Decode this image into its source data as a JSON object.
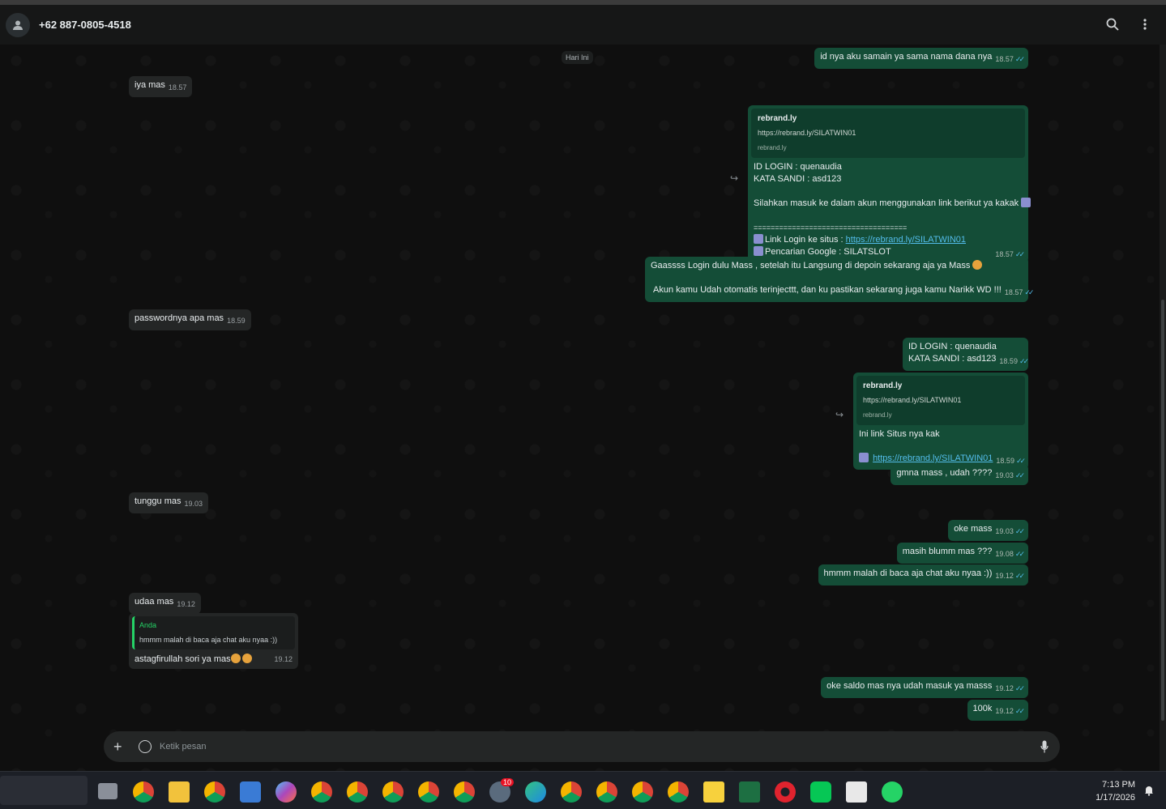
{
  "header": {
    "contact": "+62 887-0805-4518",
    "icons": [
      "person-icon",
      "search-icon",
      "more-vert-icon"
    ]
  },
  "chat": {
    "day_label": "Hari Ini",
    "messages": {
      "m1": {
        "text": "id nya aku samain ya sama nama dana nya",
        "time": "18.57"
      },
      "m2": {
        "text": "iya mas",
        "time": "18.57"
      },
      "m3": {
        "preview_title": "rebrand.ly",
        "preview_url": "https://rebrand.ly/SILATWIN01",
        "preview_domain": "rebrand.ly",
        "line1": "ID LOGIN : quenaudia",
        "line2": "KATA SANDI : asd123",
        "line3": "Silahkan masuk ke dalam akun menggunakan link berikut ya kakak",
        "line4": "====================================",
        "line5_prefix": "Link Login ke situs  : ",
        "line5_link": "https://rebrand.ly/SILATWIN01",
        "line6": "Pencarian Google : SILATSLOT",
        "time": "18.57"
      },
      "m4": {
        "line1": "Gaassss Login dulu Mass  , setelah itu Langsung di depoin sekarang aja ya Mass",
        "line2": "Akun kamu Udah otomatis terinjecttt, dan ku pastikan sekarang juga kamu Narikk WD !!!",
        "time": "18.57"
      },
      "m5": {
        "text": "passwordnya apa mas",
        "time": "18.59"
      },
      "m6": {
        "line1": "ID LOGIN : quenaudia",
        "line2": "KATA SANDI : asd123",
        "time": "18.59"
      },
      "m7": {
        "preview_title": "rebrand.ly",
        "preview_url": "https://rebrand.ly/SILATWIN01",
        "preview_domain": "rebrand.ly",
        "line1": "Ini link Situs nya kak",
        "link": "https://rebrand.ly/SILATWIN01",
        "time": "18.59"
      },
      "m8": {
        "text": "gmna mass , udah ????",
        "time": "19.03"
      },
      "m9": {
        "text": "tunggu mas",
        "time": "19.03"
      },
      "m10": {
        "text": "oke mass",
        "time": "19.03"
      },
      "m11": {
        "text": "masih blumm mas ???",
        "time": "19.08"
      },
      "m12": {
        "text": "hmmm malah di baca aja chat aku nyaa :))",
        "time": "19.12"
      },
      "m13": {
        "text": "udaa mas",
        "time": "19.12"
      },
      "m14": {
        "quote_author": "Anda",
        "quote_text": "hmmm malah di baca aja chat aku nyaa :))",
        "text": "astagfirullah sori ya mas",
        "time": "19.12"
      },
      "m15": {
        "text": "oke saldo mas nya udah masuk ya masss",
        "time": "19.12"
      },
      "m16": {
        "text": "100k",
        "time": "19.12"
      }
    }
  },
  "composer": {
    "placeholder": "Ketik pesan"
  },
  "taskbar": {
    "time": "7:13 PM",
    "date": "1/17/2026",
    "badge": "10"
  },
  "colors": {
    "incoming": "#242626",
    "outgoing": "#144d37",
    "read_tick": "#53bdeb",
    "accent": "#25d366"
  }
}
